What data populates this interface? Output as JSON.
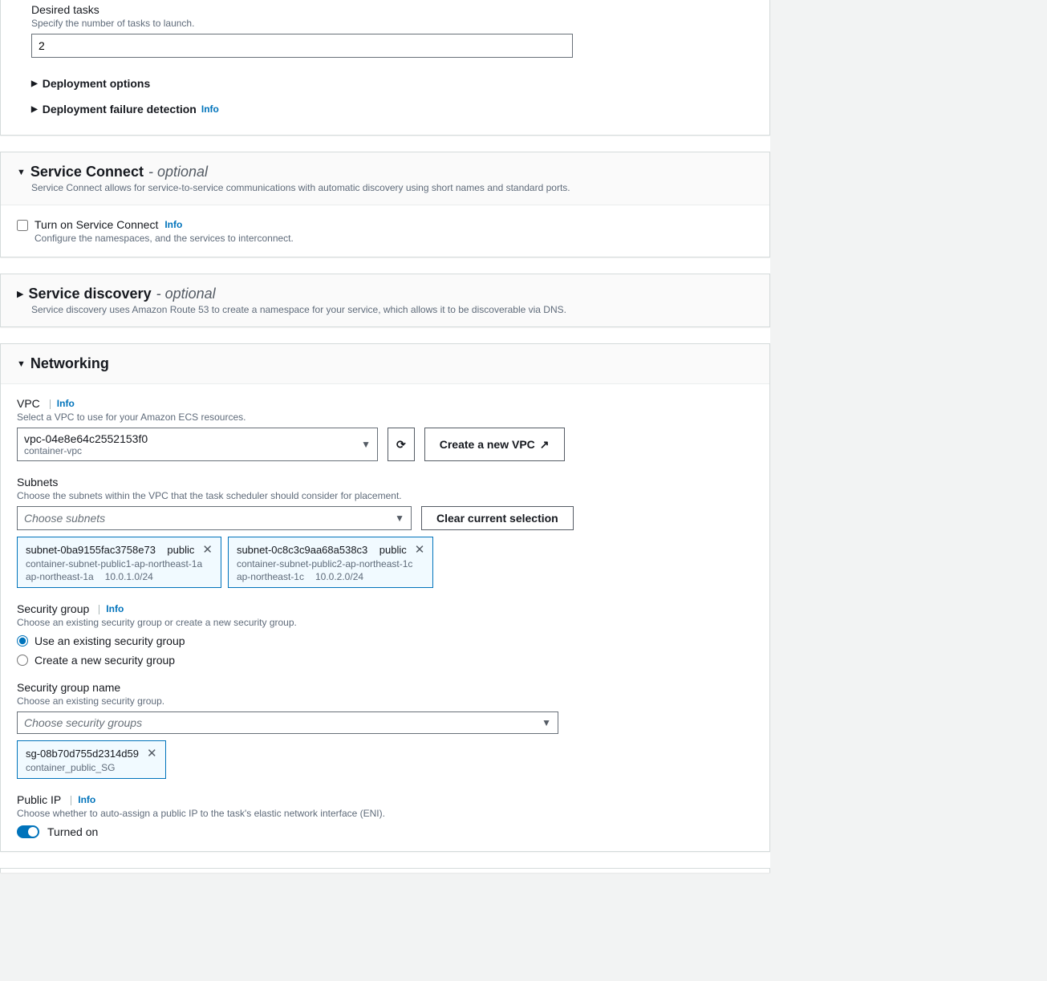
{
  "desiredTasks": {
    "label": "Desired tasks",
    "desc": "Specify the number of tasks to launch.",
    "value": "2"
  },
  "deploymentOptions": {
    "label": "Deployment options"
  },
  "deploymentFailure": {
    "label": "Deployment failure detection",
    "info": "Info"
  },
  "serviceConnect": {
    "title": "Service Connect",
    "optional": " - optional",
    "desc": "Service Connect allows for service-to-service communications with automatic discovery using short names and standard ports.",
    "checkLabel": "Turn on Service Connect",
    "checkInfo": "Info",
    "checkDesc": "Configure the namespaces, and the services to interconnect."
  },
  "serviceDiscovery": {
    "title": "Service discovery",
    "optional": " - optional",
    "desc": "Service discovery uses Amazon Route 53 to create a namespace for your service, which allows it to be discoverable via DNS."
  },
  "networking": {
    "title": "Networking",
    "vpc": {
      "label": "VPC",
      "info": "Info",
      "desc": "Select a VPC to use for your Amazon ECS resources.",
      "value": "vpc-04e8e64c2552153f0",
      "sub": "container-vpc",
      "createBtn": "Create a new VPC"
    },
    "subnets": {
      "label": "Subnets",
      "desc": "Choose the subnets within the VPC that the task scheduler should consider for placement.",
      "placeholder": "Choose subnets",
      "clearBtn": "Clear current selection",
      "items": [
        {
          "id": "subnet-0ba9155fac3758e73",
          "pub": "public",
          "name": "container-subnet-public1-ap-northeast-1a",
          "az": "ap-northeast-1a",
          "cidr": "10.0.1.0/24"
        },
        {
          "id": "subnet-0c8c3c9aa68a538c3",
          "pub": "public",
          "name": "container-subnet-public2-ap-northeast-1c",
          "az": "ap-northeast-1c",
          "cidr": "10.0.2.0/24"
        }
      ]
    },
    "securityGroup": {
      "label": "Security group",
      "info": "Info",
      "desc": "Choose an existing security group or create a new security group.",
      "existing": "Use an existing security group",
      "create": "Create a new security group",
      "nameLabel": "Security group name",
      "nameDesc": "Choose an existing security group.",
      "placeholder": "Choose security groups",
      "token": {
        "id": "sg-08b70d755d2314d59",
        "name": "container_public_SG"
      }
    },
    "publicIp": {
      "label": "Public IP",
      "info": "Info",
      "desc": "Choose whether to auto-assign a public IP to the task's elastic network interface (ENI).",
      "state": "Turned on"
    }
  }
}
